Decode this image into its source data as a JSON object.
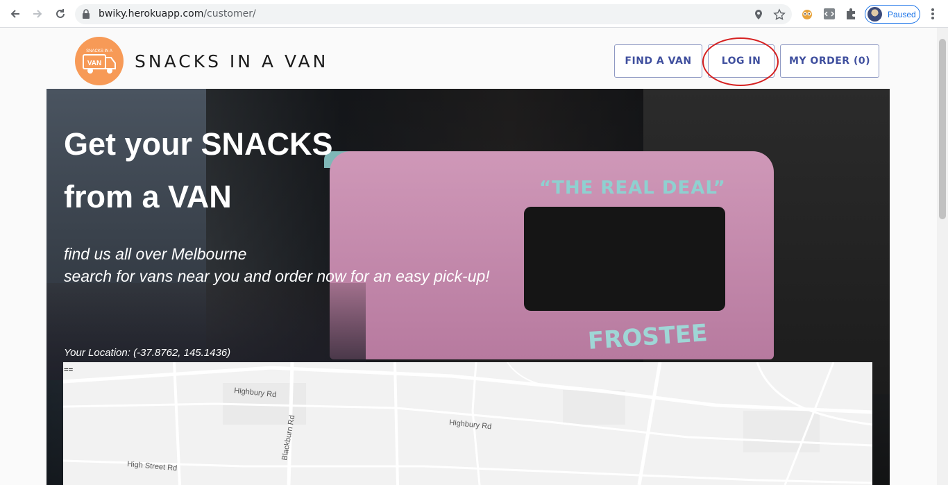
{
  "browser": {
    "url_host": "bwiky.herokuapp.com",
    "url_path": "/customer/",
    "profile_label": "Paused"
  },
  "site": {
    "logo_small_text": "SNACKS IN A",
    "logo_van_text": "VAN",
    "title": "SNACKS IN A VAN",
    "brand_color": "#f79a57"
  },
  "nav": {
    "find_van": "FIND A VAN",
    "log_in": "LOG IN",
    "my_order": "MY ORDER (0)"
  },
  "hero": {
    "line1": "Get your SNACKS",
    "line2": "from a VAN",
    "tag1": "find us all over Melbourne",
    "tag2": "search for vans near you and order now for an easy pick-up!",
    "location": "Your Location: (-37.8762, 145.1436)",
    "truck_sign": "“THE REAL DEAL”",
    "truck_brand": "FROSTEE"
  },
  "map": {
    "marker": "==",
    "roads": [
      "Highbury Rd",
      "Blackburn Rd",
      "Highbury Rd",
      "High Street Rd"
    ]
  }
}
